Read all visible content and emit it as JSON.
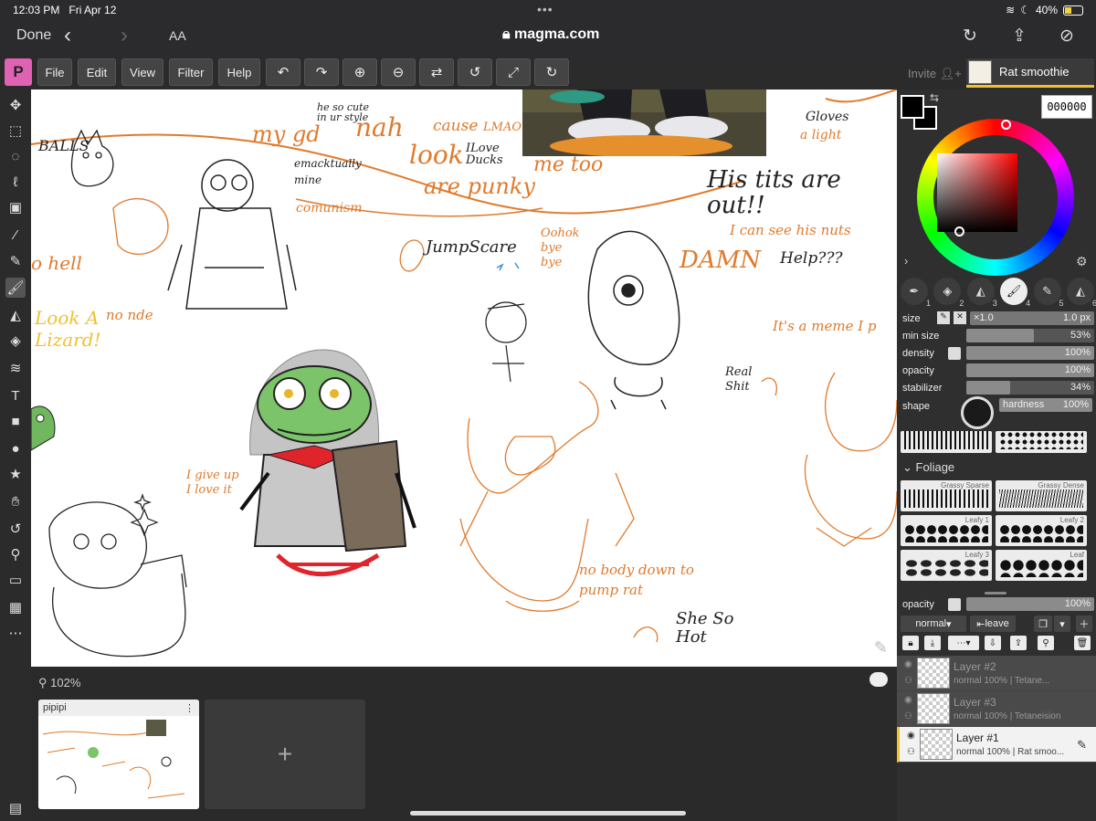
{
  "status": {
    "time": "12:03 PM",
    "date": "Fri Apr 12",
    "battery": "40%",
    "battery_level": 0.4
  },
  "safari": {
    "done": "Done",
    "aa": "AA",
    "url": "magma.com"
  },
  "menu": {
    "logo": "P",
    "file": "File",
    "edit": "Edit",
    "view": "View",
    "filter": "Filter",
    "help": "Help"
  },
  "header": {
    "invite": "Invite",
    "doc_name": "Rat smoothie"
  },
  "canvas": {
    "texts": [
      "BALLS",
      "he so cute in ur style",
      "nah",
      "my gd",
      "cause",
      "LMAO",
      "look",
      "ILove Ducks",
      "me too",
      "are punky",
      "Gloves",
      "a light",
      "emacktually mine",
      "comunism",
      "His tits are out!!",
      "I can see his nuts",
      "Help???",
      "JumpScare",
      "Oohok bye bye",
      "DAMN",
      "o hell",
      "Look A Lizard!",
      "no nde",
      "Real Shit",
      "It's a meme I p",
      "I give up I love it",
      "no body down to pump rat",
      "She So Hot"
    ]
  },
  "bottom": {
    "zoom": "102%",
    "page_title": "pipipi",
    "add": "+"
  },
  "color": {
    "hex": "000000",
    "fg": "#000000"
  },
  "brush": {
    "numbers": [
      "1",
      "2",
      "3",
      "4",
      "5",
      "6"
    ],
    "size_label": "size",
    "size_mult": "×1.0",
    "size_value": "1.0 px",
    "min_size_label": "min size",
    "min_size_value": "53%",
    "min_size_level": 0.53,
    "density_label": "density",
    "density_value": "100%",
    "density_level": 1.0,
    "opacity_label": "opacity",
    "opacity_value": "100%",
    "opacity_level": 1.0,
    "stabilizer_label": "stabilizer",
    "stabilizer_value": "34%",
    "stabilizer_level": 0.34,
    "shape_label": "shape",
    "hardness_label": "hardness",
    "hardness_value": "100%"
  },
  "library": {
    "section": "Foliage",
    "textures": [
      "Grassy Sparse",
      "Grassy Dense",
      "Leafy 1",
      "Leafy 2",
      "Leafy 3",
      "Leaf"
    ]
  },
  "layers_panel": {
    "opacity_label": "opacity",
    "opacity_value": "100%",
    "blend": "normal",
    "leave": "leave",
    "layers": [
      {
        "name": "Layer #2",
        "info": "normal 100% | Tetane..."
      },
      {
        "name": "Layer #3",
        "info": "normal 100% | Tetaneision"
      },
      {
        "name": "Layer #1",
        "info": "normal 100% | Rat smoo..."
      }
    ]
  }
}
